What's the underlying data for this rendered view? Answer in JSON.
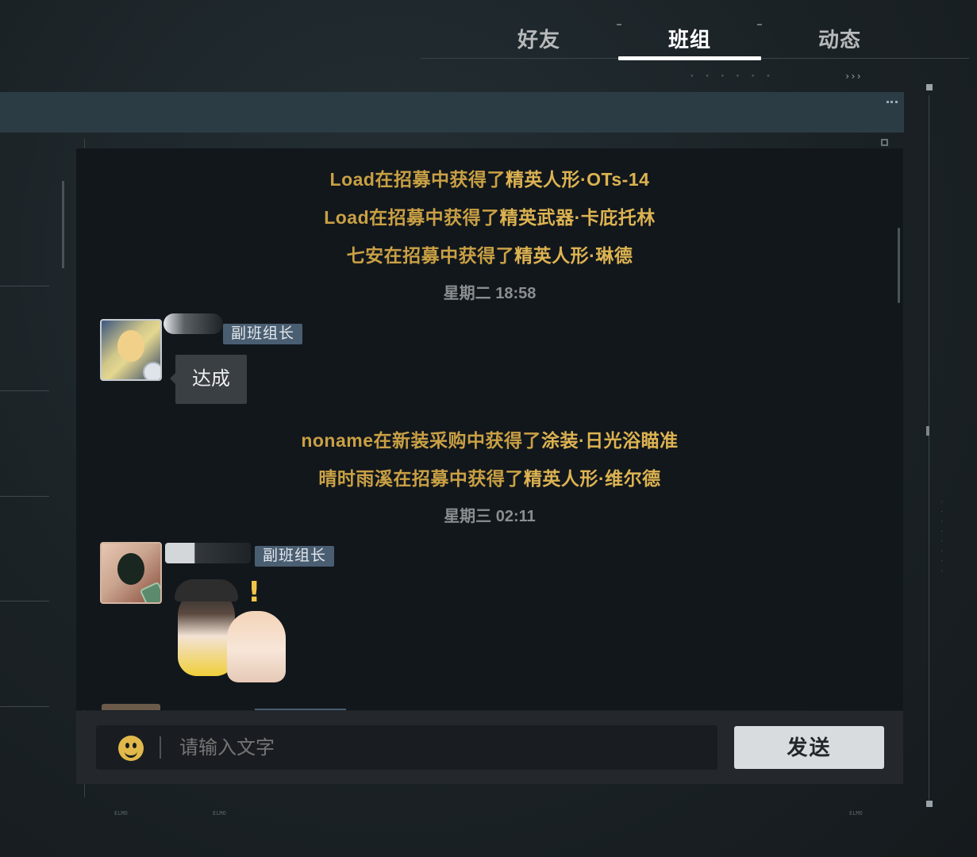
{
  "tabs": [
    {
      "label": "好友",
      "active": false
    },
    {
      "label": "班组",
      "active": true
    },
    {
      "label": "动态",
      "active": false
    }
  ],
  "decor": {
    "arrows": "›››",
    "footer_left_1": "ELMO",
    "footer_left_2": "ELMO",
    "footer_right": "ELMO"
  },
  "chat": {
    "system_messages_1": [
      {
        "actor": "Load",
        "action": "在招募中获得了",
        "item": "精英人形·OTs-14"
      },
      {
        "actor": "Load",
        "action": "在招募中获得了",
        "item": "精英武器·卡庇托林"
      },
      {
        "actor": "七安",
        "action": "在招募中获得了",
        "item": "精英人形·琳德"
      }
    ],
    "timestamp_1": "星期二 18:58",
    "message_1": {
      "role": "副班组长",
      "text": "达成"
    },
    "system_messages_2": [
      {
        "actor": "noname",
        "action": "在新装采购中获得了",
        "item": "涂装·日光浴瞄准"
      },
      {
        "actor": "晴时雨溪",
        "action": "在招募中获得了",
        "item": "精英人形·维尔德"
      }
    ],
    "timestamp_2": "星期三 02:11",
    "message_2": {
      "role": "副班组长",
      "sticker": "chibi-sticker"
    }
  },
  "input": {
    "placeholder": "请输入文字",
    "value": "",
    "send_label": "发送"
  },
  "colors": {
    "accent_gold": "#ddb351",
    "system_text": "#c9a044",
    "role_badge": "#4a5e72",
    "panel_bg": "#12171c",
    "send_button": "#d9dcde"
  }
}
